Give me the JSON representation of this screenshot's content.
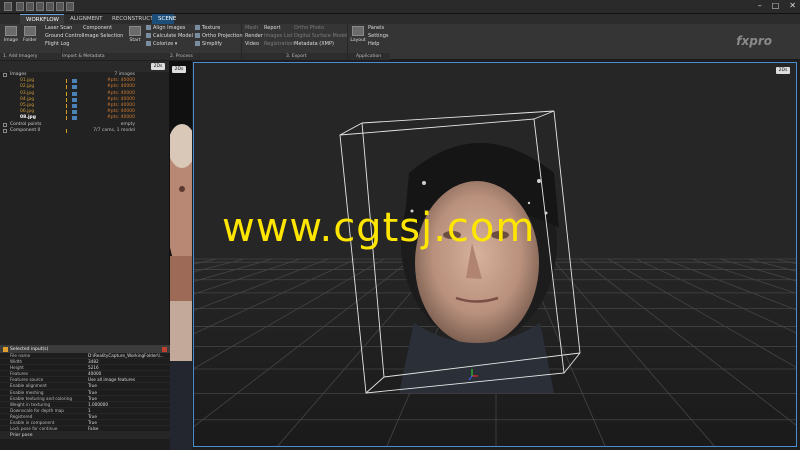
{
  "tabs": [
    "WORKFLOW",
    "ALIGNMENT",
    "RECONSTRUCTION",
    "SCENE"
  ],
  "ribbon": {
    "add_imagery": {
      "label": "1. Add Imagery",
      "image": "Image",
      "folder": "Folder",
      "laser_scan": "Laser Scan",
      "ground_control": "Ground Control",
      "flight_log": "Flight Log"
    },
    "import_metadata": {
      "label": "Import & Metadata",
      "component": "Component",
      "image_selection": "Image Selection"
    },
    "process": {
      "label": "2. Process",
      "start": "Start",
      "align_images": "Align Images",
      "calculate_model": "Calculate Model",
      "colorize": "Colorize",
      "texture": "Texture",
      "ortho_projection": "Ortho Projection",
      "simplify": "Simplify"
    },
    "export": {
      "label": "3. Export",
      "mesh": "Mesh",
      "render": "Render",
      "video": "Video",
      "report": "Report",
      "images_list": "Images List",
      "registration": "Registration",
      "ortho_photo": "Ortho Photo",
      "digital_surface_model": "Digital Surface Model",
      "metadata_xmp": "Metadata (XMP)"
    },
    "application": {
      "label": "Application",
      "layout": "Layout",
      "panels": "Panels",
      "settings": "Settings",
      "help": "Help"
    }
  },
  "logo": "fxpro",
  "view_2d_label": "2Ds",
  "tree": {
    "images_label": "Images",
    "images_count": "7 images",
    "files": [
      {
        "name": "01.jpg",
        "features": "#pts: 40000"
      },
      {
        "name": "02.jpg",
        "features": "#pts: 40000"
      },
      {
        "name": "03.jpg",
        "features": "#pts: 40000"
      },
      {
        "name": "04.jpg",
        "features": "#pts: 40000"
      },
      {
        "name": "05.jpg",
        "features": "#pts: 40000"
      },
      {
        "name": "06.jpg",
        "features": "#pts: 40000"
      },
      {
        "name": "08.jpg",
        "features": "#pts: 40000"
      }
    ],
    "control_points_label": "Control points",
    "control_points_value": "empty",
    "component_label": "Component 0",
    "component_value": "7/7 cams, 1 model"
  },
  "inspector": {
    "title": "Selected input(s)",
    "props": [
      {
        "k": "File name",
        "v": "D:\\RealityCapture_WorkingFolder\\I..."
      },
      {
        "k": "Width",
        "v": "3482"
      },
      {
        "k": "Height",
        "v": "5216"
      },
      {
        "k": "Features",
        "v": "40000"
      },
      {
        "k": "Features source",
        "v": "Use all image features"
      },
      {
        "k": "Enable alignment",
        "v": "True"
      },
      {
        "k": "Enable meshing",
        "v": "True"
      },
      {
        "k": "Enable texturing and coloring",
        "v": "True"
      },
      {
        "k": "Weight in texturing",
        "v": "1.000000"
      },
      {
        "k": "Downscale for depth map",
        "v": "1"
      },
      {
        "k": "Registered",
        "v": "True"
      },
      {
        "k": "Enable in component",
        "v": "True"
      },
      {
        "k": "Lock pose for continue",
        "v": "False"
      }
    ],
    "footer": "Prior pose"
  },
  "watermark": "www.cgtsj.com",
  "colors": {
    "accent": "#4b8ed0",
    "watermark": "#ffe600",
    "feature_text": "#d07a30"
  }
}
